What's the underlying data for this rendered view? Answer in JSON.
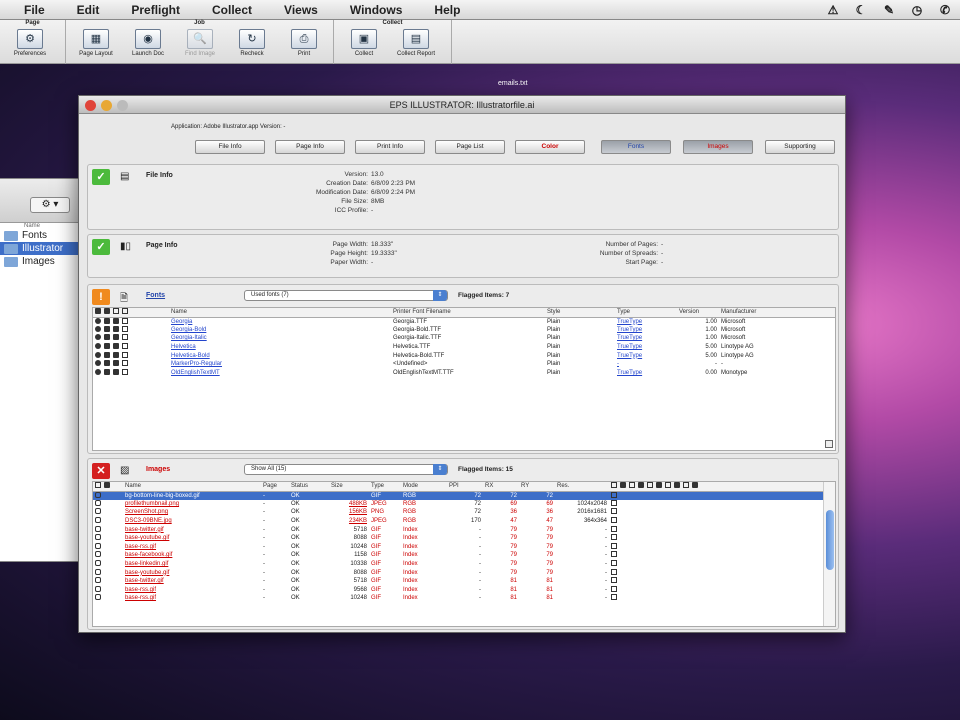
{
  "menubar": {
    "items": [
      "File",
      "Edit",
      "Preflight",
      "Collect",
      "Views",
      "Windows",
      "Help"
    ],
    "status_icons": [
      "warning-icon",
      "moon-icon",
      "script-icon",
      "clock-icon",
      "phone-icon"
    ]
  },
  "toolbar": {
    "groups": [
      {
        "label": "Page",
        "buttons": [
          {
            "label": "Preferences",
            "icon": "⚙"
          }
        ]
      },
      {
        "label": "Job",
        "buttons": [
          {
            "label": "Page Layout",
            "icon": "▦"
          },
          {
            "label": "Launch Doc",
            "icon": "◉"
          },
          {
            "label": "Find Image",
            "icon": "🔍"
          },
          {
            "label": "Recheck",
            "icon": "↻"
          },
          {
            "label": "Print",
            "icon": "⎙"
          }
        ]
      },
      {
        "label": "Collect",
        "buttons": [
          {
            "label": "Collect",
            "icon": "▣"
          },
          {
            "label": "Collect Report",
            "icon": "▤"
          }
        ]
      }
    ]
  },
  "desktop": {
    "file_label": "emails.txt"
  },
  "finder": {
    "column_header": "Name",
    "items": [
      "Fonts",
      "Illustrator",
      "Images"
    ]
  },
  "window": {
    "title": "EPS ILLUSTRATOR: Illustratorfile.ai",
    "app_info": "Application: Adobe Illustrator.app Version: -",
    "tabs": [
      "File Info",
      "Page Info",
      "Print Info",
      "Page List",
      "Color",
      "Fonts",
      "Images",
      "Supporting"
    ]
  },
  "file_info": {
    "title": "File Info",
    "fields": [
      {
        "k": "Version:",
        "v": "13.0"
      },
      {
        "k": "Creation Date:",
        "v": "6/8/09 2:23 PM"
      },
      {
        "k": "Modification Date:",
        "v": "6/8/09 2:24 PM"
      },
      {
        "k": "File Size:",
        "v": "8MB"
      },
      {
        "k": "ICC Profile:",
        "v": "-"
      }
    ]
  },
  "page_info": {
    "title": "Page Info",
    "left": [
      {
        "k": "Page Width:",
        "v": "18.333\""
      },
      {
        "k": "Page Height:",
        "v": "19.3333\""
      },
      {
        "k": "Paper Width:",
        "v": "-"
      }
    ],
    "right": [
      {
        "k": "Number of Pages:",
        "v": "-"
      },
      {
        "k": "Number of Spreads:",
        "v": "-"
      },
      {
        "k": "Start Page:",
        "v": "-"
      }
    ]
  },
  "fonts": {
    "title": "Fonts",
    "filter": "Used fonts (7)",
    "flagged": "Flagged Items: 7",
    "columns": [
      "Name",
      "Printer Font Filename",
      "Style",
      "Type",
      "Version",
      "Manufacturer"
    ],
    "rows": [
      {
        "name": "Georgia",
        "file": "Georgia.TTF",
        "style": "Plain",
        "type": "TrueType",
        "version": "1.00",
        "mfr": "Microsoft"
      },
      {
        "name": "Georgia-Bold",
        "file": "Georgia-Bold.TTF",
        "style": "Plain",
        "type": "TrueType",
        "version": "1.00",
        "mfr": "Microsoft"
      },
      {
        "name": "Georgia-Italic",
        "file": "Georgia-Italic.TTF",
        "style": "Plain",
        "type": "TrueType",
        "version": "1.00",
        "mfr": "Microsoft"
      },
      {
        "name": "Helvetica",
        "file": "Helvetica.TTF",
        "style": "Plain",
        "type": "TrueType",
        "version": "5.00",
        "mfr": "Linotype AG"
      },
      {
        "name": "Helvetica-Bold",
        "file": "Helvetica-Bold.TTF",
        "style": "Plain",
        "type": "TrueType",
        "version": "5.00",
        "mfr": "Linotype AG"
      },
      {
        "name": "MarkerPro-Regular",
        "file": "<Undefined>",
        "style": "Plain",
        "type": "-",
        "version": "-",
        "mfr": "-"
      },
      {
        "name": "OldEnglishTextMT",
        "file": "OldEnglishTextMT.TTF",
        "style": "Plain",
        "type": "TrueType",
        "version": "0.00",
        "mfr": "Monotype"
      }
    ]
  },
  "images": {
    "title": "Images",
    "filter": "Show All (15)",
    "flagged": "Flagged Items: 15",
    "columns": [
      "Name",
      "Page",
      "Status",
      "Size",
      "Type",
      "Mode",
      "PPI",
      "RX",
      "RY",
      "Res."
    ],
    "rows": [
      {
        "name": "bg-bottom-line-big-boxed.gif",
        "page": "-",
        "status": "OK",
        "size": "",
        "type": "GIF",
        "mode": "RGB",
        "ppi": "72",
        "rx": "72",
        "ry": "72",
        "res": "",
        "selected": true
      },
      {
        "name": "profilethumbnail.png",
        "page": "-",
        "status": "OK",
        "size": "488KB",
        "type": "JPEG",
        "mode": "RGB",
        "ppi": "72",
        "rx": "69",
        "ry": "69",
        "res": "1024x2048"
      },
      {
        "name": "ScreenShot.png",
        "page": "-",
        "status": "OK",
        "size": "156KB",
        "type": "PNG",
        "mode": "RGB",
        "ppi": "72",
        "rx": "36",
        "ry": "36",
        "res": "2016x1681"
      },
      {
        "name": "DSC3-09BNE.jpg",
        "page": "-",
        "status": "OK",
        "size": "234KB",
        "type": "JPEG",
        "mode": "RGB",
        "ppi": "170",
        "rx": "47",
        "ry": "47",
        "res": "364x364"
      },
      {
        "name": "base-twitter.gif",
        "page": "-",
        "status": "OK",
        "size": "5718",
        "type": "GIF",
        "mode": "Index",
        "ppi": "-",
        "rx": "79",
        "ry": "79",
        "res": "-"
      },
      {
        "name": "base-youtube.gif",
        "page": "-",
        "status": "OK",
        "size": "8088",
        "type": "GIF",
        "mode": "Index",
        "ppi": "-",
        "rx": "79",
        "ry": "79",
        "res": "-"
      },
      {
        "name": "base-rss.gif",
        "page": "-",
        "status": "OK",
        "size": "10248",
        "type": "GIF",
        "mode": "Index",
        "ppi": "-",
        "rx": "79",
        "ry": "79",
        "res": "-"
      },
      {
        "name": "base-facebook.gif",
        "page": "-",
        "status": "OK",
        "size": "1158",
        "type": "GIF",
        "mode": "Index",
        "ppi": "-",
        "rx": "79",
        "ry": "79",
        "res": "-"
      },
      {
        "name": "base-linkedin.gif",
        "page": "-",
        "status": "OK",
        "size": "10338",
        "type": "GIF",
        "mode": "Index",
        "ppi": "-",
        "rx": "79",
        "ry": "79",
        "res": "-"
      },
      {
        "name": "base-youtube.gif",
        "page": "-",
        "status": "OK",
        "size": "8088",
        "type": "GIF",
        "mode": "Index",
        "ppi": "-",
        "rx": "79",
        "ry": "79",
        "res": "-"
      },
      {
        "name": "base-twitter.gif",
        "page": "-",
        "status": "OK",
        "size": "5718",
        "type": "GIF",
        "mode": "Index",
        "ppi": "-",
        "rx": "81",
        "ry": "81",
        "res": "-"
      },
      {
        "name": "base-rss.gif",
        "page": "-",
        "status": "OK",
        "size": "9568",
        "type": "GIF",
        "mode": "Index",
        "ppi": "-",
        "rx": "81",
        "ry": "81",
        "res": "-"
      },
      {
        "name": "base-rss.gif",
        "page": "-",
        "status": "OK",
        "size": "10248",
        "type": "GIF",
        "mode": "Index",
        "ppi": "-",
        "rx": "81",
        "ry": "81",
        "res": "-"
      }
    ]
  }
}
